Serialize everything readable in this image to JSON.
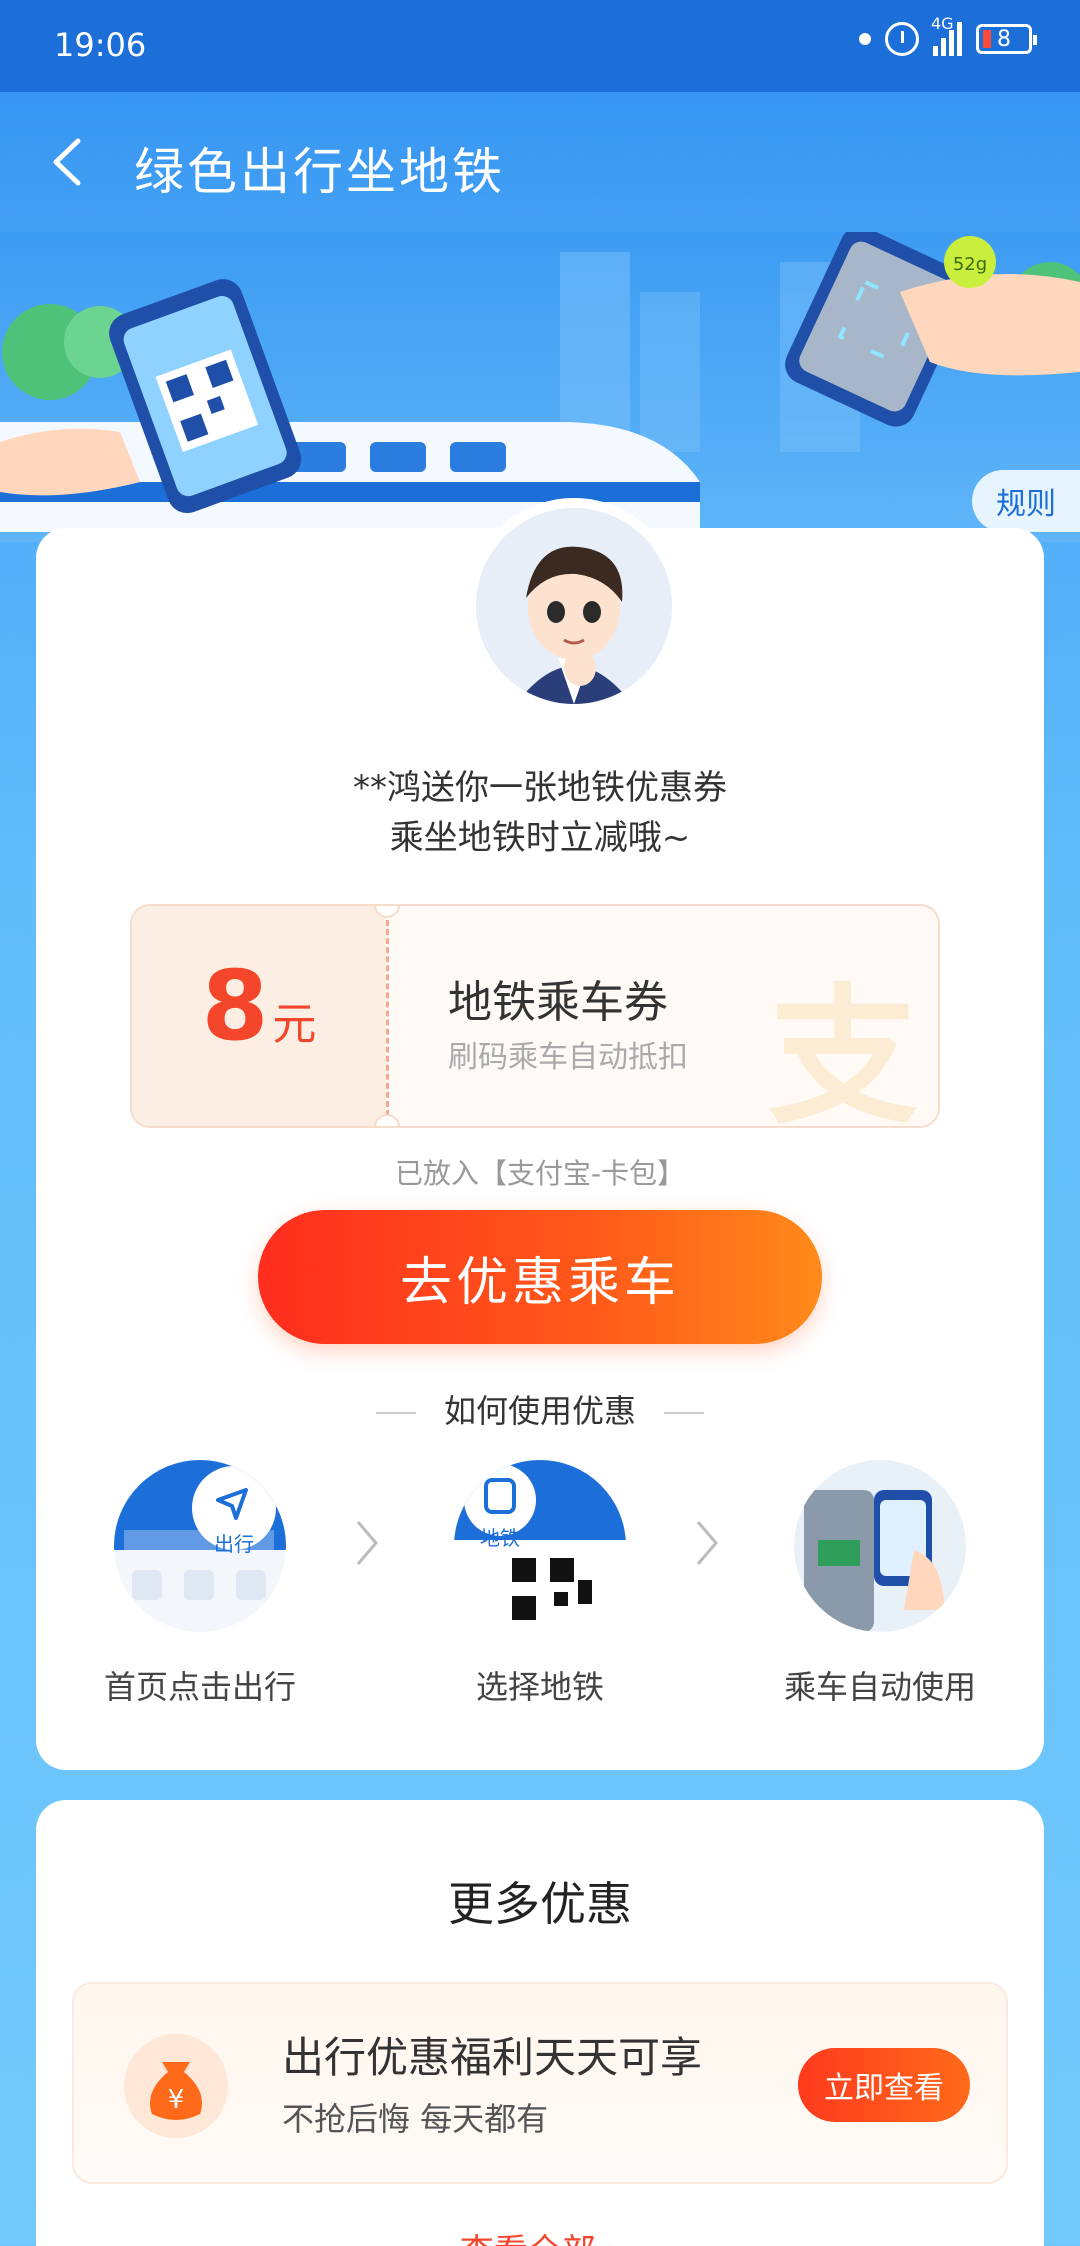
{
  "status": {
    "time": "19:06",
    "network": "4G",
    "battery": "8"
  },
  "header": {
    "title": "绿色出行坐地铁"
  },
  "banner": {
    "rule_label": "规则",
    "bubble_text": "52g"
  },
  "invite": {
    "line1": "**鸿送你一张地铁优惠券",
    "line2": "乘坐地铁时立减哦~"
  },
  "coupon": {
    "amount": "8",
    "unit": "元",
    "name": "地铁乘车券",
    "desc": "刷码乘车自动抵扣",
    "watermark": "支"
  },
  "wallet_note": "已放入【支付宝-卡包】",
  "go_button": "去优惠乘车",
  "howto": {
    "title": "如何使用优惠",
    "steps": [
      {
        "label": "首页点击出行",
        "badge": "出行"
      },
      {
        "label": "选择地铁",
        "badge": "地铁"
      },
      {
        "label": "乘车自动使用"
      }
    ]
  },
  "more": {
    "title": "更多优惠",
    "promo": {
      "title": "出行优惠福利天天可享",
      "subtitle": "不抢后悔 每天都有",
      "button": "立即查看",
      "icon_glyph": "¥"
    },
    "view_all": "查看全部 ›"
  },
  "colors": {
    "accent": "#f4462a",
    "brand_blue": "#1c6fd8"
  }
}
